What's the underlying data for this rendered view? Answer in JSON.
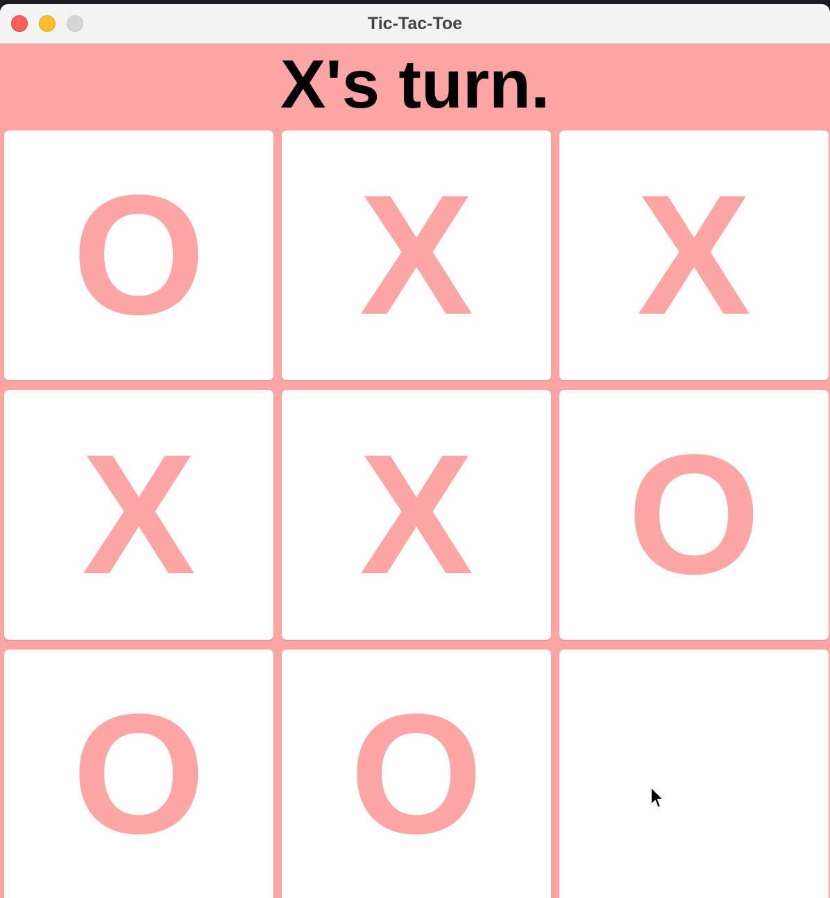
{
  "window": {
    "title": "Tic-Tac-Toe"
  },
  "status": {
    "text": "X's turn."
  },
  "board": {
    "cells": [
      "O",
      "X",
      "X",
      "X",
      "X",
      "O",
      "O",
      "O",
      ""
    ]
  },
  "colors": {
    "background": "#fca5a5",
    "mark": "#fca5a5",
    "cell": "#fffdfd",
    "status_text": "#000000"
  },
  "icons": {
    "close": "close-icon",
    "minimize": "minimize-icon",
    "zoom": "zoom-icon",
    "cursor": "mouse-pointer-icon"
  }
}
